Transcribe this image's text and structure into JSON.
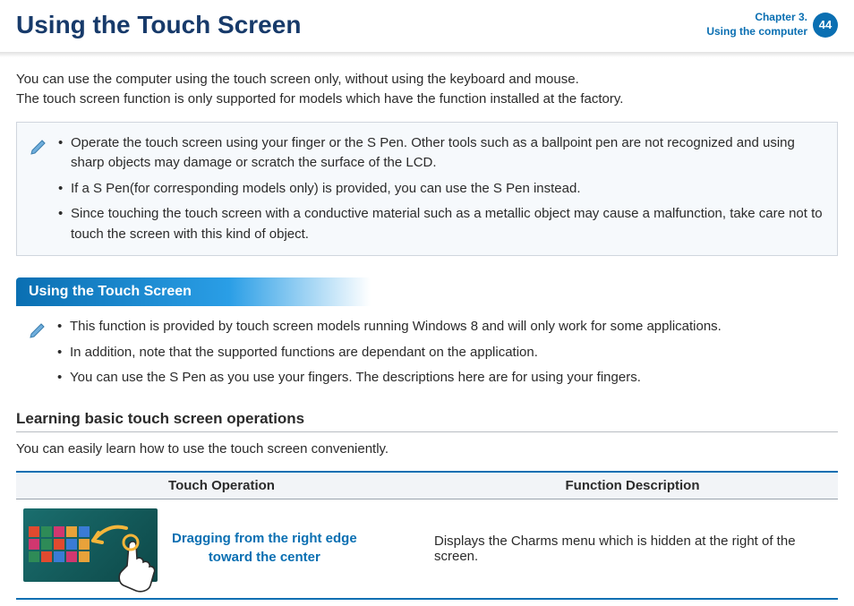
{
  "header": {
    "title": "Using the Touch Screen",
    "chapter_line1": "Chapter 3.",
    "chapter_line2": "Using the computer",
    "page_number": "44"
  },
  "intro": {
    "line1": "You can use the computer using the touch screen only, without using the keyboard and mouse.",
    "line2": "The touch screen function is only supported for models which have the function installed at the factory."
  },
  "note1": {
    "items": [
      "Operate the touch screen using your finger or the S Pen. Other tools such as a ballpoint pen are not recognized and using sharp objects may damage or scratch the surface of the LCD.",
      "If a S Pen(for corresponding models only) is provided, you can use the S Pen instead.",
      "Since touching the touch screen with a conductive material such as a metallic object may cause a malfunction, take care not to touch the screen with this kind of object."
    ]
  },
  "section": {
    "pill": "Using the Touch Screen"
  },
  "note2": {
    "items": [
      "This function is provided by touch screen models running Windows 8 and will only work for some applications.",
      "In addition, note that the supported functions are dependant on the application.",
      "You can use the S Pen as you use your fingers. The descriptions here are for using your fingers."
    ]
  },
  "learning": {
    "heading": "Learning basic touch screen operations",
    "text": "You can easily learn how to use the touch screen conveniently."
  },
  "table": {
    "col1": "Touch Operation",
    "col2": "Function Description",
    "row1": {
      "op_line1": "Dragging from the right edge",
      "op_line2": "toward the center",
      "desc": "Displays the Charms menu which is hidden at the right of the screen."
    }
  },
  "tiles": [
    "#e04a2f",
    "#2e8b57",
    "#d1376f",
    "#e8a23a",
    "#3a7bd5",
    "#d1376f",
    "#2e8b57",
    "#e04a2f",
    "#3a7bd5",
    "#e8a23a",
    "#2e8b57",
    "#e04a2f",
    "#3a7bd5",
    "#d1376f",
    "#e8a23a"
  ]
}
